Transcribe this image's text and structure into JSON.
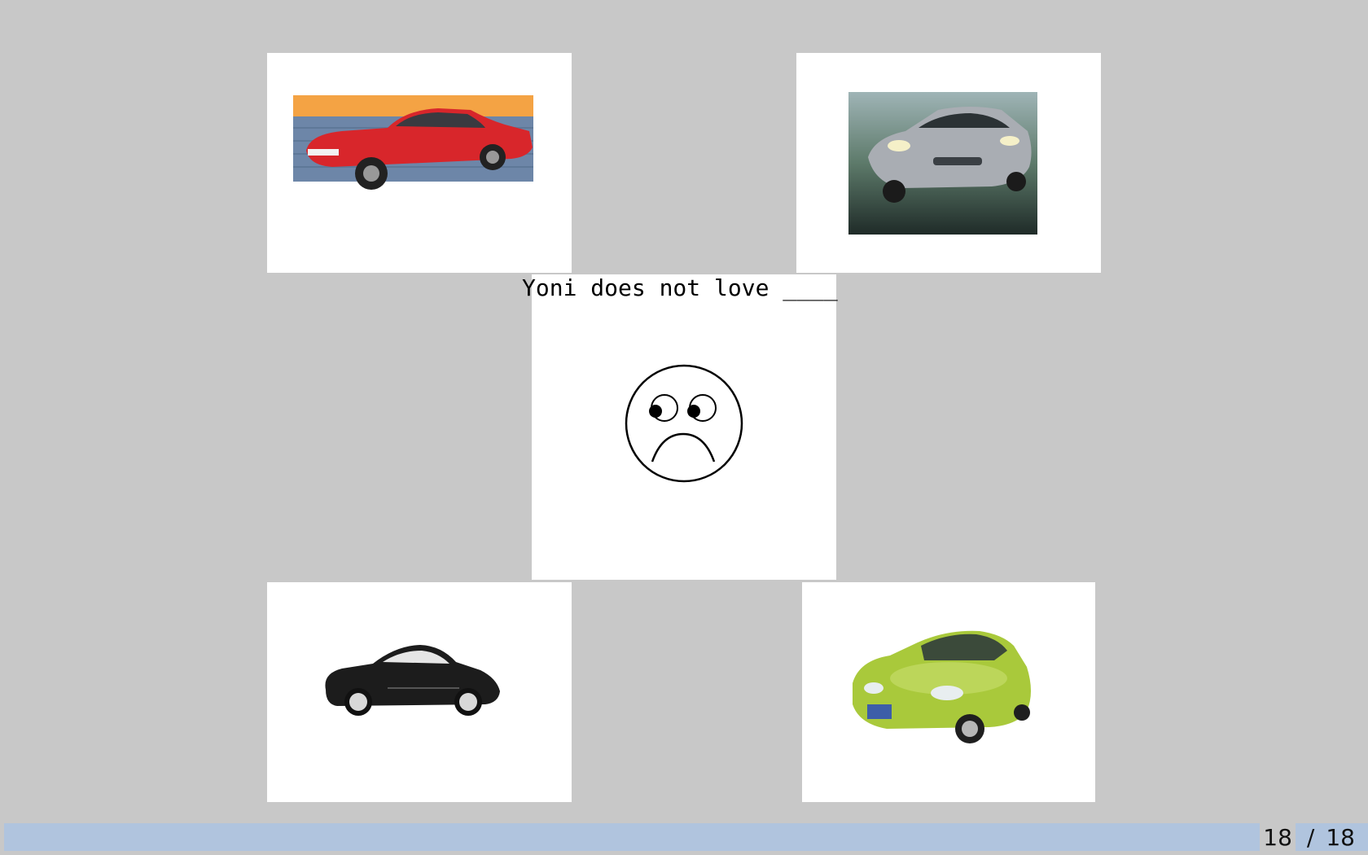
{
  "slide": {
    "caption": "Yoni does not love ____",
    "images": [
      {
        "name": "red-muscle-car",
        "color": "#d8262b"
      },
      {
        "name": "silver-sports-car",
        "color": "#a9adb3"
      },
      {
        "name": "sad-face",
        "color": "#000000"
      },
      {
        "name": "black-coupe",
        "color": "#1c1c1c"
      },
      {
        "name": "green-hatchback",
        "color": "#a9c93b"
      }
    ]
  },
  "footer": {
    "current_page": "18",
    "separator": "/",
    "total_pages": "18",
    "bar_color": "#b0c4de"
  }
}
